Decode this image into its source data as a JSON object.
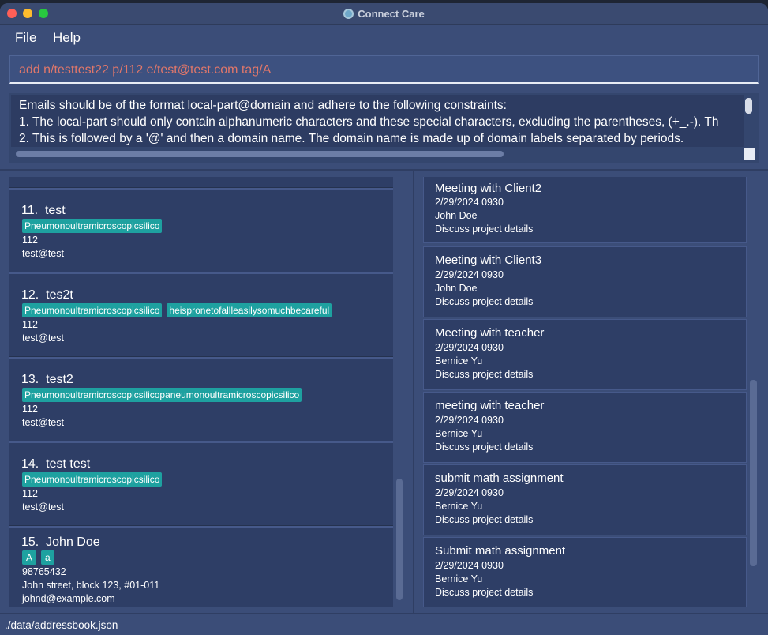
{
  "window": {
    "title": "Connect Care"
  },
  "menu": {
    "file": "File",
    "help": "Help"
  },
  "command": {
    "value": "add n/testtest22 p/112 e/test@test.com tag/A"
  },
  "result": {
    "lines": [
      "Emails should be of the format local-part@domain and adhere to the following constraints:",
      "1. The local-part should only contain alphanumeric characters and these special characters, excluding the parentheses, (+_.-). Th",
      "2. This is followed by a '@' and then a domain name. The domain name is made up of domain labels separated by periods."
    ]
  },
  "persons": [
    {
      "index": "11.",
      "name": "test",
      "tags": [
        "Pneumonoultramicroscopicsilico"
      ],
      "phone": "112",
      "email": "test@test"
    },
    {
      "index": "12.",
      "name": "tes2t",
      "tags": [
        "Pneumonoultramicroscopicsilico",
        "heispronetofallleasilysomuchbecareful"
      ],
      "phone": "112",
      "email": "test@test"
    },
    {
      "index": "13.",
      "name": "test2",
      "tags": [
        "Pneumonoultramicroscopicsilicopaneumonoultramicroscopicsilico"
      ],
      "phone": "112",
      "email": "test@test"
    },
    {
      "index": "14.",
      "name": "test test",
      "tags": [
        "Pneumonoultramicroscopicsilico"
      ],
      "phone": "112",
      "email": "test@test"
    },
    {
      "index": "15.",
      "name": "John Doe",
      "tags": [
        "A",
        "a"
      ],
      "phone": "98765432",
      "address": "John street, block 123, #01-011",
      "email": "johnd@example.com"
    }
  ],
  "meetings": [
    {
      "title": "Meeting with Client2",
      "datetime": "2/29/2024 0930",
      "attendee": "John Doe",
      "agenda": "Discuss project details"
    },
    {
      "title": "Meeting with Client3",
      "datetime": "2/29/2024 0930",
      "attendee": "John Doe",
      "agenda": "Discuss project details"
    },
    {
      "title": "Meeting with teacher",
      "datetime": "2/29/2024 0930",
      "attendee": "Bernice Yu",
      "agenda": "Discuss project details"
    },
    {
      "title": "meeting with teacher",
      "datetime": "2/29/2024 0930",
      "attendee": "Bernice Yu",
      "agenda": "Discuss project details"
    },
    {
      "title": "submit math assignment",
      "datetime": "2/29/2024 0930",
      "attendee": "Bernice Yu",
      "agenda": "Discuss project details"
    },
    {
      "title": "Submit math assignment",
      "datetime": "2/29/2024 0930",
      "attendee": "Bernice Yu",
      "agenda": "Discuss project details"
    }
  ],
  "status": {
    "path": "./data/addressbook.json"
  },
  "colors": {
    "background": "#3b4d78",
    "card": "#2e3e66",
    "tag": "#1ea1a0",
    "command_text": "#e0776a"
  }
}
